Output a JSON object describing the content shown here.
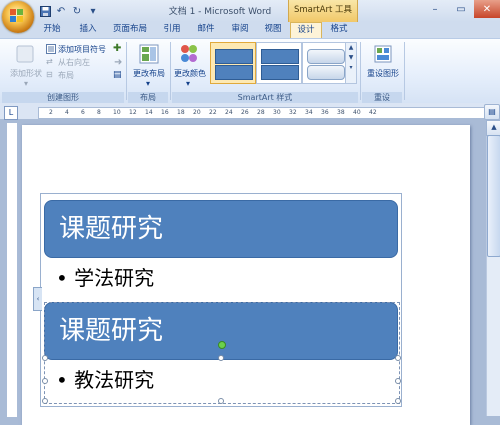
{
  "window": {
    "title": "文档 1 - Microsoft Word",
    "context_tab_header": "SmartArt 工具",
    "controls": [
      "minimize-icon",
      "maximize-icon",
      "close-icon"
    ]
  },
  "quick_access": [
    "save-icon",
    "undo-icon",
    "redo-icon",
    "customize-icon"
  ],
  "tabs": [
    {
      "label": "开始",
      "active": false
    },
    {
      "label": "插入",
      "active": false
    },
    {
      "label": "页面布局",
      "active": false
    },
    {
      "label": "引用",
      "active": false
    },
    {
      "label": "邮件",
      "active": false
    },
    {
      "label": "审阅",
      "active": false
    },
    {
      "label": "视图",
      "active": false
    },
    {
      "label": "设计",
      "active": true
    },
    {
      "label": "格式",
      "active": false
    }
  ],
  "ribbon": {
    "create_graphic": {
      "group_label": "创建图形",
      "add_shape": "添加形状",
      "add_bullet": "添加项目符号",
      "right_to_left": "从右向左",
      "layout": "布局"
    },
    "layouts": {
      "group_label": "布局",
      "change_layout": "更改布局"
    },
    "smartart_styles": {
      "group_label": "SmartArt 样式",
      "change_colors": "更改颜色",
      "selected_style_index": 0
    },
    "reset": {
      "group_label": "重设",
      "reset_graphic": "重设图形"
    }
  },
  "ruler": {
    "ticks": [
      "2",
      "4",
      "6",
      "8",
      "10",
      "12",
      "14",
      "16",
      "18",
      "20",
      "22",
      "24",
      "26",
      "28",
      "30",
      "32",
      "34",
      "36",
      "38",
      "40",
      "42"
    ]
  },
  "document": {
    "smartart": {
      "items": [
        {
          "heading": "课题研究",
          "bullet": "学法研究"
        },
        {
          "heading": "课题研究",
          "bullet": "教法研究"
        }
      ]
    }
  },
  "colors": {
    "shape_fill": "#4f81bd",
    "context_tab": "#f1c869"
  }
}
